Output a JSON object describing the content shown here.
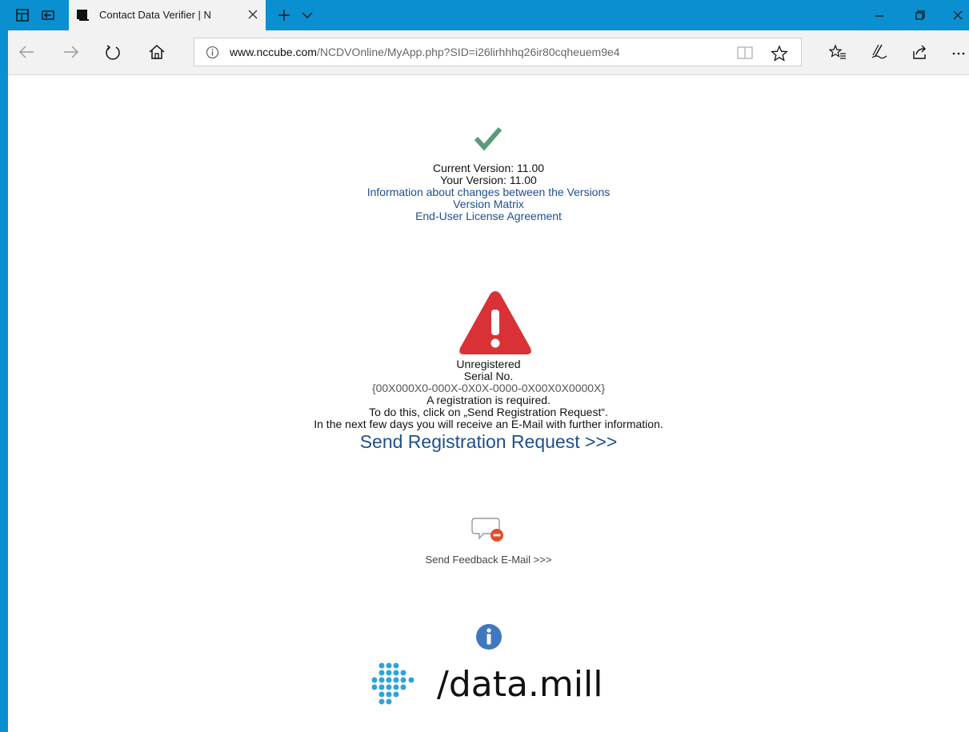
{
  "browser": {
    "tab_title": "Contact Data Verifier | N",
    "url_host": "www.nccube.com",
    "url_path": "/NCDVOnline/MyApp.php?SID=i26lirhhhq26ir80cqheuem9e4"
  },
  "version_block": {
    "current_version": "Current Version: 11.00",
    "your_version": "Your Version: 11.00",
    "changes_link": "Information about changes between the Versions",
    "matrix_link": "Version Matrix",
    "eula_link": "End-User License Agreement"
  },
  "registration_block": {
    "status": "Unregistered",
    "serial_label": "Serial No.",
    "serial_value": "{00X000X0-000X-0X0X-0000-0X00X0X0000X}",
    "required": "A registration is required.",
    "instruction": "To do this, click on „Send Registration Request“.",
    "followup": "In the next few days you will receive an E-Mail with further information.",
    "send_link": "Send Registration Request >>>"
  },
  "feedback": {
    "link": "Send Feedback E-Mail >>>"
  },
  "brand": {
    "logo_text": "/data.mill"
  },
  "colors": {
    "check": "#5b9a7a",
    "warning": "#d83236",
    "info": "#3f78c0",
    "link": "#1f4f8f",
    "dots": "#2ea3dc"
  },
  "icons": {
    "check": "checkmark-icon",
    "warning": "warning-triangle-icon",
    "feedback": "speech-bubble-icon",
    "info": "info-icon"
  }
}
